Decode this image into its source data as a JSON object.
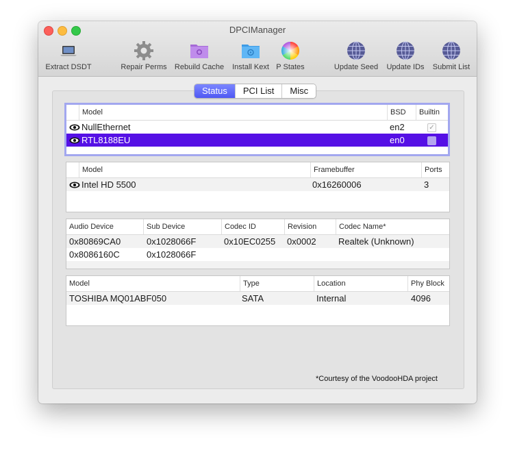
{
  "window": {
    "title": "DPCIManager"
  },
  "toolbar": {
    "items": [
      {
        "label": "Extract DSDT",
        "icon": "laptop-icon"
      },
      {
        "label": "Repair Perms",
        "icon": "gear-icon"
      },
      {
        "label": "Rebuild Cache",
        "icon": "purple-folder-icon"
      },
      {
        "label": "Install Kext",
        "icon": "blue-folder-icon"
      },
      {
        "label": "P States",
        "icon": "color-wheel-icon"
      },
      {
        "label": "Update Seed",
        "icon": "globe-icon"
      },
      {
        "label": "Update IDs",
        "icon": "globe-icon"
      },
      {
        "label": "Submit List",
        "icon": "globe-icon"
      }
    ]
  },
  "tabs": [
    {
      "label": "Status",
      "active": true
    },
    {
      "label": "PCI List",
      "active": false
    },
    {
      "label": "Misc",
      "active": false
    }
  ],
  "network": {
    "headers": {
      "model": "Model",
      "bsd": "BSD",
      "builtin": "Builtin"
    },
    "rows": [
      {
        "model": "NullEthernet",
        "bsd": "en2",
        "builtin": true,
        "selected": false
      },
      {
        "model": "RTL8188EU",
        "bsd": "en0",
        "builtin": false,
        "selected": true
      }
    ]
  },
  "graphics": {
    "headers": {
      "model": "Model",
      "framebuffer": "Framebuffer",
      "ports": "Ports"
    },
    "rows": [
      {
        "model": "Intel HD 5500",
        "framebuffer": "0x16260006",
        "ports": "3"
      }
    ]
  },
  "audio": {
    "headers": {
      "device": "Audio Device",
      "sub": "Sub Device",
      "codec": "Codec ID",
      "rev": "Revision",
      "name": "Codec Name*"
    },
    "rows": [
      {
        "device": "0x80869CA0",
        "sub": "0x1028066F",
        "codec": "0x10EC0255",
        "rev": "0x0002",
        "name": "Realtek (Unknown)"
      },
      {
        "device": "0x8086160C",
        "sub": "0x1028066F",
        "codec": "",
        "rev": "",
        "name": ""
      }
    ]
  },
  "storage": {
    "headers": {
      "model": "Model",
      "type": "Type",
      "location": "Location",
      "block": "Phy Block"
    },
    "rows": [
      {
        "model": "TOSHIBA MQ01ABF050",
        "type": "SATA",
        "location": "Internal",
        "block": "4096"
      }
    ]
  },
  "footnote": "*Courtesy of the VoodooHDA project",
  "colors": {
    "accent": "#5510e5",
    "tab_active": "#5b64f5"
  }
}
